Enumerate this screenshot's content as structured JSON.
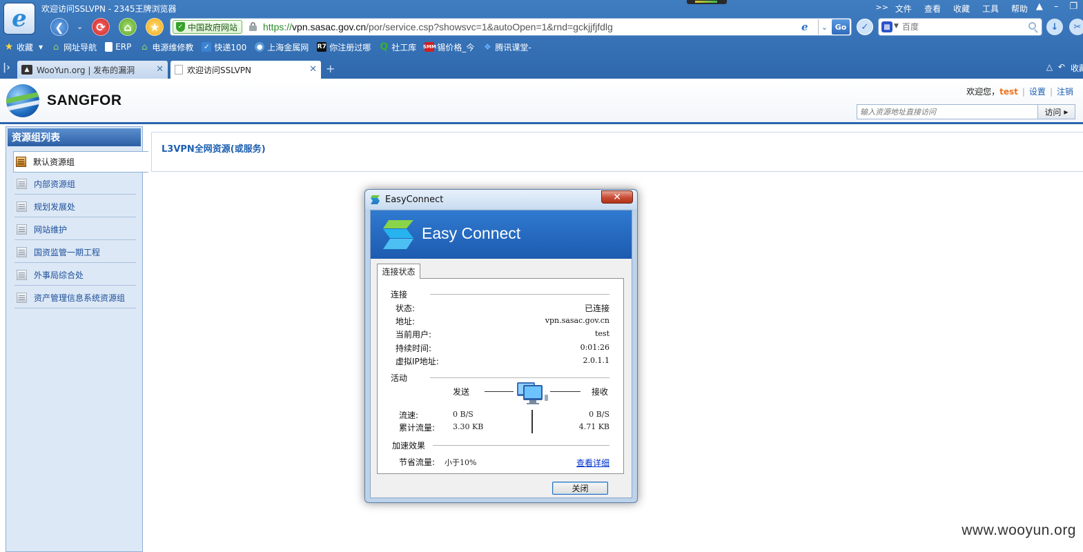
{
  "browser": {
    "window_title": "欢迎访问SSLVPN - 2345王牌浏览器",
    "menu": [
      "文件",
      "查看",
      "收藏",
      "工具",
      "帮助"
    ],
    "menu_chevron": ">>",
    "gov_badge": "中国政府网站",
    "url_scheme": "https://",
    "url_host": "vpn.sasac.gov.cn",
    "url_path": "/por/service.csp?showsvc=1&autoOpen=1&rnd=gckjjfjfdlg",
    "go_label": "Go",
    "search_placeholder": "百度",
    "bookmarks": [
      {
        "label": "收藏",
        "icon": "star-icon"
      },
      {
        "label": "网址导航",
        "icon": "house-icon"
      },
      {
        "label": "ERP",
        "icon": "doc-icon"
      },
      {
        "label": "电源维修教",
        "icon": "house-icon"
      },
      {
        "label": "快递100",
        "icon": "kuaidi-icon"
      },
      {
        "label": "上海金属网",
        "icon": "globe-icon"
      },
      {
        "label": "你注册过哪",
        "icon": "r7-icon"
      },
      {
        "label": "社工库",
        "icon": "q-icon"
      },
      {
        "label": "锡价格_今",
        "icon": "smm-icon"
      },
      {
        "label": "腾讯课堂-",
        "icon": "tencent-icon"
      }
    ],
    "tabs": [
      {
        "title": "WooYun.org | 发布的漏洞",
        "active": false
      },
      {
        "title": "欢迎访问SSLVPN",
        "active": true
      }
    ],
    "tab_new": "+",
    "tab_right_label": "收藏"
  },
  "header": {
    "brand": "SANGFOR",
    "welcome": "欢迎您，",
    "username": "test",
    "settings": "设置",
    "logout": "注销",
    "visit_placeholder": "输入资源地址直接访问",
    "visit_button": "访问"
  },
  "sidebar": {
    "title": "资源组列表",
    "items": [
      {
        "label": "默认资源组",
        "active": true
      },
      {
        "label": "内部资源组"
      },
      {
        "label": "规划发展处"
      },
      {
        "label": "网站维护"
      },
      {
        "label": "国资监管一期工程"
      },
      {
        "label": "外事局综合处"
      },
      {
        "label": "资产管理信息系统资源组"
      }
    ]
  },
  "main": {
    "title": "L3VPN全网资源(或服务)"
  },
  "dialog": {
    "title": "EasyConnect",
    "banner": "Easy Connect",
    "tab": "连接状态",
    "connection": {
      "heading": "连接",
      "rows": [
        {
          "label": "状态:",
          "value": "已连接"
        },
        {
          "label": "地址:",
          "value": "vpn.sasac.gov.cn"
        },
        {
          "label": "当前用户:",
          "value": "test"
        },
        {
          "label": "持续时间:",
          "value": "0:01:26"
        },
        {
          "label": "虚拟IP地址:",
          "value": "2.0.1.1"
        }
      ]
    },
    "activity": {
      "heading": "活动",
      "send": "发送",
      "receive": "接收",
      "speed_label": "流速:",
      "speed_send": "0 B/S",
      "speed_recv": "0 B/S",
      "total_label": "累计流量:",
      "total_send": "3.30 KB",
      "total_recv": "4.71 KB"
    },
    "accel": {
      "heading": "加速效果",
      "label": "节省流量:",
      "value": "小于10%",
      "link": "查看详细"
    },
    "close_button": "关闭"
  },
  "watermark": "www.wooyun.org"
}
